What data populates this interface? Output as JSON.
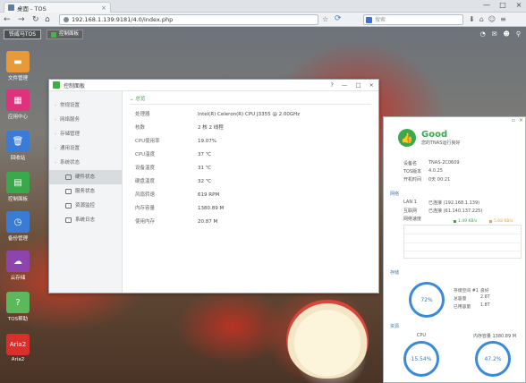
{
  "browser": {
    "tab_title": "桌面 - TOS",
    "url": "192.168.1.139:9181/4.0/index.php",
    "search_placeholder": "搜索"
  },
  "desktop": {
    "logo": "铁威马TOS",
    "taskbar_item": "控制面板",
    "icons": [
      {
        "label": "文件管理",
        "icon": "folder-icon",
        "color": "#e89a3a"
      },
      {
        "label": "应用中心",
        "icon": "app-center-icon",
        "color": "#e0317d"
      },
      {
        "label": "回收站",
        "icon": "trash-icon",
        "color": "#3a7bd5"
      },
      {
        "label": "控制面板",
        "icon": "control-panel-icon",
        "color": "#3aa94b"
      },
      {
        "label": "备份管理",
        "icon": "backup-icon",
        "color": "#3a7bd5"
      },
      {
        "label": "云存储",
        "icon": "cloud-icon",
        "color": "#8e44ad"
      },
      {
        "label": "TOS帮助",
        "icon": "help-icon",
        "color": "#5cb85c"
      },
      {
        "label": "Aria2",
        "icon": "aria2-icon",
        "color": "#d9302c"
      }
    ]
  },
  "control_panel": {
    "title": "控制面板",
    "sidebar": [
      {
        "label": "常规设置",
        "type": "group"
      },
      {
        "label": "网络服务",
        "type": "group"
      },
      {
        "label": "存储管理",
        "type": "group"
      },
      {
        "label": "通用设置",
        "type": "group"
      },
      {
        "label": "系统状态",
        "type": "group"
      },
      {
        "label": "硬件状态",
        "type": "sub",
        "active": true
      },
      {
        "label": "服务状态",
        "type": "sub",
        "active": false
      },
      {
        "label": "资源监控",
        "type": "sub",
        "active": false
      },
      {
        "label": "系统日志",
        "type": "sub",
        "active": false
      }
    ],
    "section_title": "总览",
    "rows": [
      {
        "k": "处理器",
        "v": "Intel(R) Celeron(R) CPU J3355 @ 2.00GHz"
      },
      {
        "k": "核数",
        "v": "2 核 2 线程"
      },
      {
        "k": "CPU使用率",
        "v": "19.07%"
      },
      {
        "k": "CPU温度",
        "v": "37 ℃"
      },
      {
        "k": "设备温度",
        "v": "31 ℃"
      },
      {
        "k": "硬盘温度",
        "v": "32 ℃"
      },
      {
        "k": "风扇转速",
        "v": "619 RPM"
      },
      {
        "k": "内存容量",
        "v": "1380.89 M"
      },
      {
        "k": "使用内存",
        "v": "20.87 M"
      }
    ]
  },
  "dashboard": {
    "status": "Good",
    "status_sub": "您的TNAS运行良好",
    "device_name_k": "设备名",
    "device_name_v": "TNAS-2C0609",
    "tos_k": "TOS版本",
    "tos_v": "4.0.25",
    "uptime_k": "开机时间",
    "uptime_v": "0天 00:21",
    "network_label": "网络",
    "lan_k": "LAN 1",
    "lan_v": "已连接 (192.168.1.139)",
    "internet_k": "互联网",
    "internet_v": "已连接 (61.140.137.225)",
    "speed_k": "网络速度",
    "speed_up": "1.49 KB/s",
    "speed_down": "5.68 KB/s",
    "storage_label": "存储",
    "storage_pct": "72%",
    "storage_rows": [
      {
        "k": "存储空间 #1",
        "v": "良好"
      },
      {
        "k": "总容量",
        "v": "2.6T"
      },
      {
        "k": "已用容量",
        "v": "1.8T"
      }
    ],
    "resource_label": "资源",
    "cpu_label": "CPU",
    "cpu_pct": "15.54%",
    "mem_label": "内存容量 1380.89 M",
    "mem_pct": "47.2%"
  }
}
